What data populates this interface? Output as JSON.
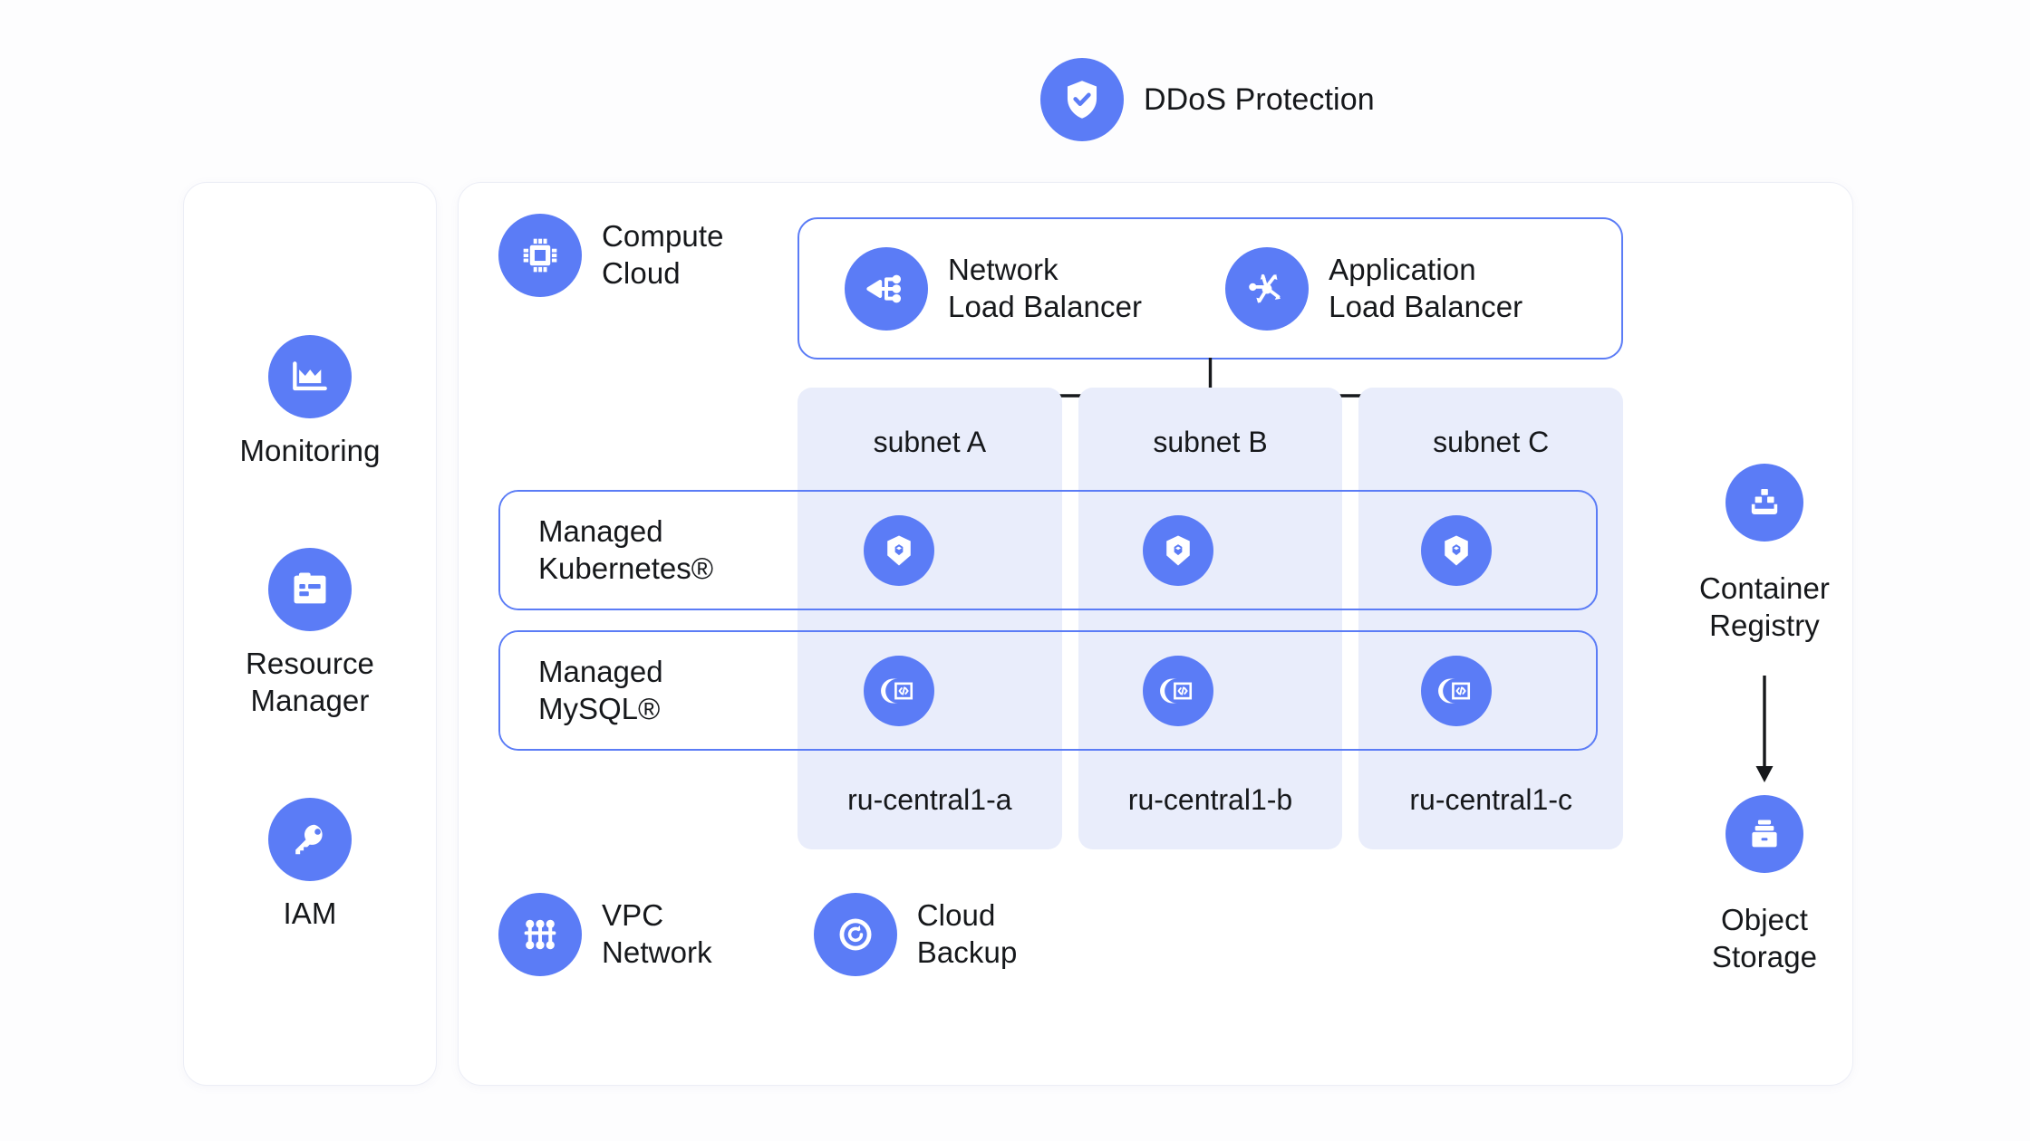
{
  "header": {
    "ddos": {
      "label": "DDoS Protection",
      "icon": "shield-check-icon"
    }
  },
  "sidebar": {
    "items": [
      {
        "label": "Monitoring",
        "icon": "monitoring-chart-icon"
      },
      {
        "label": "Resource\nManager",
        "icon": "resource-manager-icon"
      },
      {
        "label": "IAM",
        "icon": "key-icon"
      }
    ]
  },
  "main": {
    "compute": {
      "label": "Compute\nCloud",
      "icon": "cpu-chip-icon"
    },
    "load_balancers": [
      {
        "label": "Network\nLoad Balancer",
        "icon": "network-load-balancer-icon"
      },
      {
        "label": "Application\nLoad Balancer",
        "icon": "application-load-balancer-icon"
      }
    ],
    "subnets": [
      {
        "name": "subnet A",
        "zone": "ru-central1-a"
      },
      {
        "name": "subnet B",
        "zone": "ru-central1-b"
      },
      {
        "name": "subnet C",
        "zone": "ru-central1-c"
      }
    ],
    "bands": [
      {
        "label": "Managed\nKubernetes®",
        "icon": "kubernetes-icon"
      },
      {
        "label": "Managed\nMySQL®",
        "icon": "managed-database-icon"
      }
    ],
    "bottom_services": [
      {
        "label": "VPC\nNetwork",
        "icon": "vpc-network-icon"
      },
      {
        "label": "Cloud\nBackup",
        "icon": "backup-restore-icon"
      }
    ]
  },
  "right_column": {
    "items": [
      {
        "label": "Container\nRegistry",
        "icon": "container-registry-icon"
      },
      {
        "label": "Object\nStorage",
        "icon": "object-storage-icon"
      }
    ]
  },
  "colors": {
    "accent": "#5b7cf6",
    "subnet_bg": "#e9edfb",
    "panel_border": "#eceef6",
    "text": "#16181b",
    "canvas": "#fdfdfe"
  }
}
